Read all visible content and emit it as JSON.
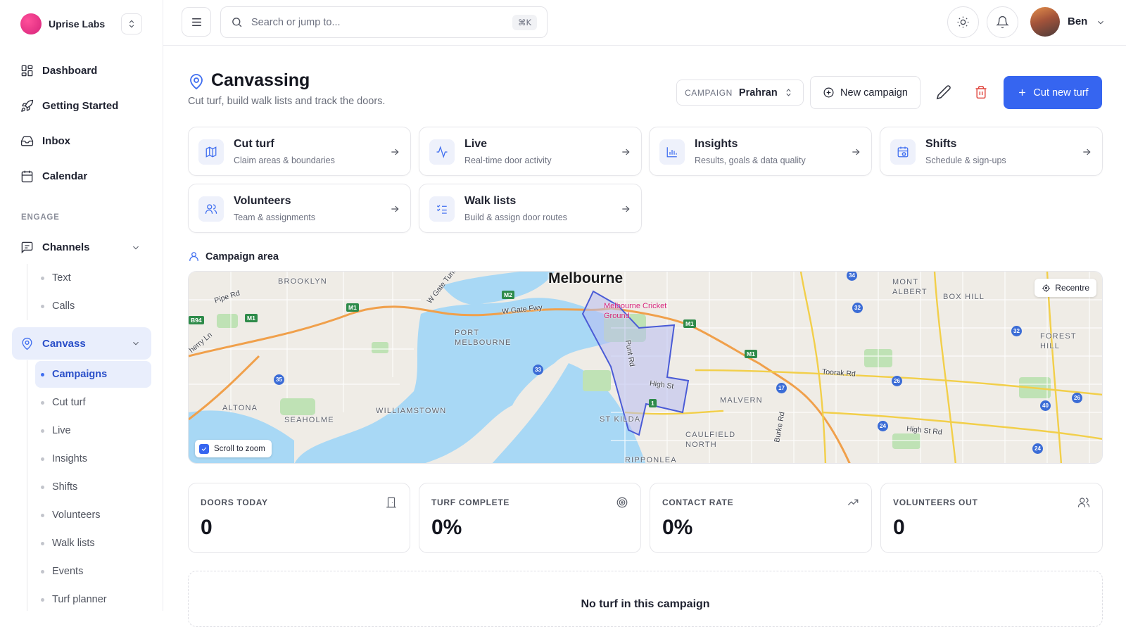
{
  "brand": {
    "name": "Uprise Labs",
    "logo_color": "#e0307f"
  },
  "sidebar": {
    "main": [
      {
        "label": "Dashboard",
        "icon": "grid-icon"
      },
      {
        "label": "Getting Started",
        "icon": "rocket-icon"
      },
      {
        "label": "Inbox",
        "icon": "inbox-icon"
      },
      {
        "label": "Calendar",
        "icon": "calendar-icon"
      }
    ],
    "section_title": "ENGAGE",
    "channels": {
      "label": "Channels",
      "items": [
        "Text",
        "Calls"
      ]
    },
    "canvass": {
      "label": "Canvass",
      "items": [
        "Campaigns",
        "Cut turf",
        "Live",
        "Insights",
        "Shifts",
        "Volunteers",
        "Walk lists",
        "Events",
        "Turf planner"
      ],
      "active": "Campaigns"
    }
  },
  "topbar": {
    "search_placeholder": "Search or jump to...",
    "search_shortcut": "⌘K",
    "user_name": "Ben"
  },
  "header": {
    "title": "Canvassing",
    "subtitle": "Cut turf, build walk lists and track the doors.",
    "campaign_label": "CAMPAIGN",
    "campaign_value": "Prahran",
    "new_campaign_label": "New campaign",
    "cut_turf_label": "Cut new turf",
    "accent_color": "#3665f0"
  },
  "cards": [
    {
      "title": "Cut turf",
      "subtitle": "Claim areas & boundaries",
      "icon": "map-icon"
    },
    {
      "title": "Live",
      "subtitle": "Real-time door activity",
      "icon": "activity-icon"
    },
    {
      "title": "Insights",
      "subtitle": "Results, goals & data quality",
      "icon": "bar-chart-icon"
    },
    {
      "title": "Shifts",
      "subtitle": "Schedule & sign-ups",
      "icon": "calendar-clock-icon"
    },
    {
      "title": "Volunteers",
      "subtitle": "Team & assignments",
      "icon": "users-icon"
    },
    {
      "title": "Walk lists",
      "subtitle": "Build & assign door routes",
      "icon": "list-checks-icon"
    }
  ],
  "map": {
    "title": "Campaign area",
    "recentre_label": "Recentre",
    "scroll_zoom_label": "Scroll to zoom",
    "scroll_zoom_checked": true,
    "city": "Melbourne",
    "landmark": "Melbourne Cricket Ground",
    "suburbs": [
      "BROOKLYN",
      "PORT MELBOURNE",
      "ALTONA",
      "SEAHOLME",
      "WILLIAMSTOWN",
      "ST KILDA",
      "MALVERN",
      "CAULFIELD NORTH",
      "MONT ALBERT",
      "BOX HILL",
      "FOREST HILL",
      "RIPPONLEA"
    ],
    "roads": [
      "Pipe Rd",
      "W Gate Fwy",
      "Punt Rd",
      "High St",
      "Toorak Rd",
      "Burke Rd",
      "High St Rd",
      "W Gate Tunl",
      "herry Ln"
    ],
    "highway_shields": [
      "M1",
      "M2",
      "B94",
      "M1",
      "M1",
      "M1"
    ],
    "route_markers": [
      "35",
      "33",
      "32",
      "17",
      "26",
      "40",
      "24",
      "24",
      "26",
      "32",
      "34",
      "1"
    ]
  },
  "stats": [
    {
      "label": "DOORS TODAY",
      "value": "0",
      "icon": "door-icon"
    },
    {
      "label": "TURF COMPLETE",
      "value": "0%",
      "icon": "target-icon"
    },
    {
      "label": "CONTACT RATE",
      "value": "0%",
      "icon": "trending-up-icon"
    },
    {
      "label": "VOLUNTEERS OUT",
      "value": "0",
      "icon": "users-icon"
    }
  ],
  "empty_state": {
    "title": "No turf in this campaign"
  }
}
